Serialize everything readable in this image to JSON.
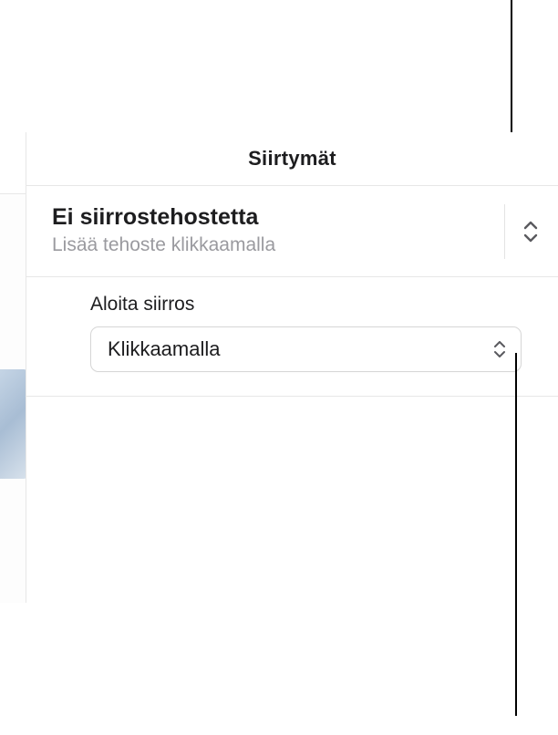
{
  "toolbar": {
    "format_icon": "format-paintbrush-icon",
    "animate_icon": "animate-diamond-icon"
  },
  "inspector": {
    "tab_title": "Siirtymät",
    "effect": {
      "title": "Ei siirrostehostetta",
      "subtitle": "Lisää tehoste klikkaamalla"
    },
    "start": {
      "label": "Aloita siirros",
      "value": "Klikkaamalla"
    }
  }
}
